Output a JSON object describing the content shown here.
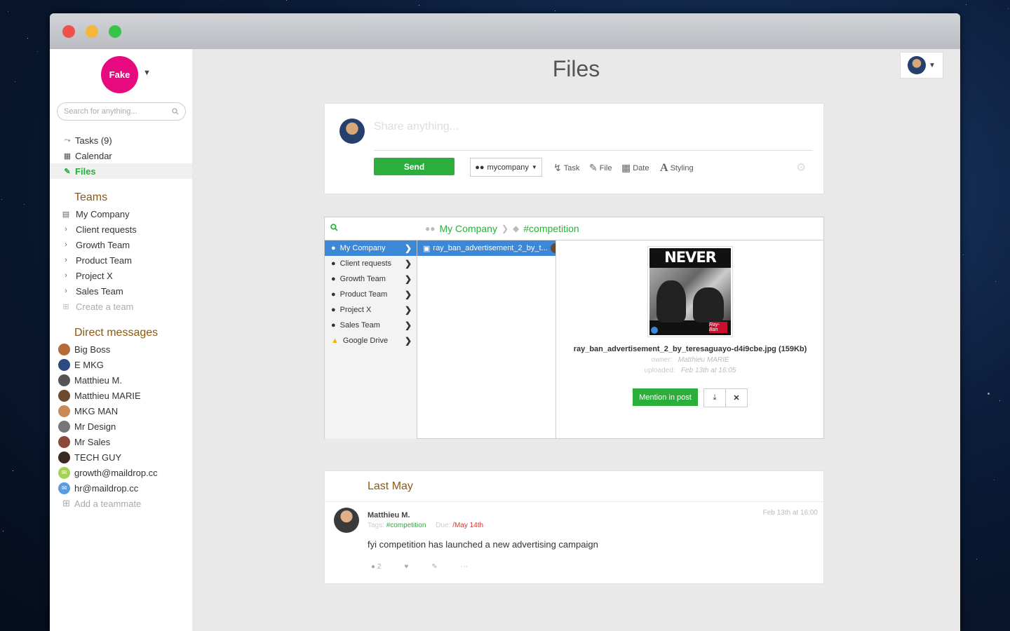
{
  "app": {
    "logo_text": "Fake",
    "page_title": "Files"
  },
  "sidebar": {
    "search_placeholder": "Search for anything...",
    "nav": [
      {
        "icon": "bolt-icon",
        "label": "Tasks (9)"
      },
      {
        "icon": "calendar-icon",
        "label": "Calendar"
      },
      {
        "icon": "paperclip-icon",
        "label": "Files"
      }
    ],
    "teams_title": "Teams",
    "teams": [
      {
        "icon": "building-icon",
        "label": "My Company"
      },
      {
        "icon": "chevron-right-icon",
        "label": "Client requests"
      },
      {
        "icon": "chevron-right-icon",
        "label": "Growth Team"
      },
      {
        "icon": "chevron-right-icon",
        "label": "Product Team"
      },
      {
        "icon": "chevron-right-icon",
        "label": "Project X"
      },
      {
        "icon": "chevron-right-icon",
        "label": "Sales Team"
      },
      {
        "icon": "plus-square-icon",
        "label": "Create a team"
      }
    ],
    "dm_title": "Direct messages",
    "direct_messages": [
      {
        "label": "Big Boss",
        "color": "#b56a3a"
      },
      {
        "label": "E MKG",
        "color": "#2a4a80"
      },
      {
        "label": "Matthieu M.",
        "color": "#555555"
      },
      {
        "label": "Matthieu MARIE",
        "color": "#6b4a2f"
      },
      {
        "label": "MKG MAN",
        "color": "#c88a5a"
      },
      {
        "label": "Mr Design",
        "color": "#777777"
      },
      {
        "label": "Mr Sales",
        "color": "#8a4a3a"
      },
      {
        "label": "TECH GUY",
        "color": "#3a2a22"
      },
      {
        "label": "growth@maildrop.cc",
        "color": "#a5d156"
      },
      {
        "label": "hr@maildrop.cc",
        "color": "#5b9be0"
      }
    ],
    "add_teammate": "Add a teammate"
  },
  "composer": {
    "placeholder": "Share anything...",
    "send_label": "Send",
    "target_label": "mycompany",
    "tools": [
      {
        "icon": "bolt-icon",
        "label": "Task"
      },
      {
        "icon": "paperclip-icon",
        "label": "File"
      },
      {
        "icon": "calendar-icon",
        "label": "Date"
      },
      {
        "icon": "font-icon",
        "label": "Styling"
      }
    ]
  },
  "browser": {
    "breadcrumb": [
      "My Company",
      "#competition"
    ],
    "folders": [
      {
        "icon": "group-icon",
        "label": "My Company"
      },
      {
        "icon": "group-icon",
        "label": "Client requests"
      },
      {
        "icon": "group-icon",
        "label": "Growth Team"
      },
      {
        "icon": "group-icon",
        "label": "Product Team"
      },
      {
        "icon": "group-icon",
        "label": "Project X"
      },
      {
        "icon": "group-icon",
        "label": "Sales Team"
      },
      {
        "icon": "google-drive-icon",
        "label": "Google Drive"
      }
    ],
    "file_item": "ray_ban_advertisement_2_by_t...",
    "preview": {
      "image_text": "NEVER HIDE",
      "brand_text": "Ray-Ban",
      "filename": "ray_ban_advertisement_2_by_teresaguayo-d4i9cbe.jpg (159Kb)",
      "owner_label": "owner:",
      "owner_value": "Matthieu MARIE",
      "uploaded_label": "uploaded:",
      "uploaded_value": "Feb 13th at 16:05",
      "mention_label": "Mention in post"
    }
  },
  "post": {
    "section_title": "Last May",
    "author": "Matthieu M.",
    "timestamp": "Feb 13th at 16:00",
    "tags_label": "Tags:",
    "tag": "#competition",
    "due_label": "Due:",
    "due_value": "/May 14th",
    "body": "fyi competition has launched a new advertising campaign",
    "comment_count": "2"
  },
  "colors": {
    "accent": "#2cae3c",
    "brand": "#e8097e",
    "selection": "#3c87d6",
    "section_title": "#8a5a12"
  }
}
